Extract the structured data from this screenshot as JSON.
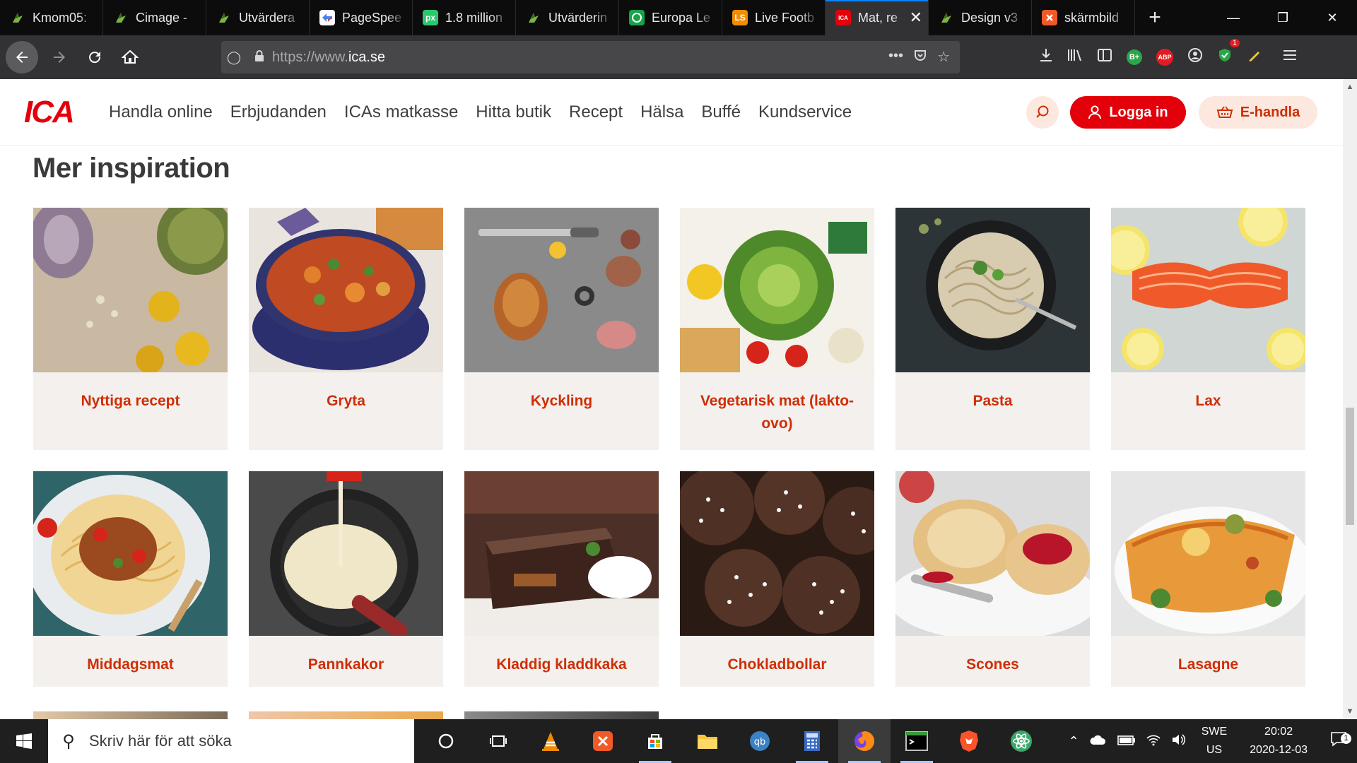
{
  "browser": {
    "tabs": [
      {
        "title": "Kmom05:",
        "icon": "web-icon",
        "color": "#3a5a1a"
      },
      {
        "title": "Cimage -",
        "icon": "web-icon",
        "color": "#3a5a1a"
      },
      {
        "title": "Utvärdera",
        "icon": "web-icon",
        "color": "#3a5a1a"
      },
      {
        "title": "PageSpee",
        "icon": "pagespeed-icon",
        "color": "#ffffff"
      },
      {
        "title": "1.8 million",
        "icon": "pixabay-icon",
        "color": "#2ec66d"
      },
      {
        "title": "Utvärderin",
        "icon": "web-icon",
        "color": "#3a5a1a"
      },
      {
        "title": "Europa Le",
        "icon": "europa-icon",
        "color": "#16a34a"
      },
      {
        "title": "Live Footb",
        "icon": "livescore-icon",
        "color": "#f28c00"
      },
      {
        "title": "Mat, re",
        "icon": "ica-icon",
        "color": "#e3000b",
        "active": true
      },
      {
        "title": "Design v3",
        "icon": "web-icon",
        "color": "#3a5a1a"
      },
      {
        "title": "skärmbild",
        "icon": "snip-icon",
        "color": "#f05a28"
      }
    ],
    "new_tab": "+",
    "url_proto": "https://www.",
    "url_domain": "ica.se",
    "url_dots": "•••",
    "abp_badge": "ABP",
    "b_badge": "B+",
    "update_count": "1"
  },
  "site": {
    "logo": "ICA",
    "nav": [
      "Handla online",
      "Erbjudanden",
      "ICAs matkasse",
      "Hitta butik",
      "Recept",
      "Hälsa",
      "Buffé",
      "Kundservice"
    ],
    "login": "Logga in",
    "ehandla": "E-handla",
    "section_title": "Mer inspiration",
    "cards": [
      {
        "label": "Nyttiga recept",
        "image": "vegetables-pumpkin"
      },
      {
        "label": "Gryta",
        "image": "stew-pot"
      },
      {
        "label": "Kyckling",
        "image": "roast-chicken"
      },
      {
        "label": "Vegetarisk mat (lakto-ovo)",
        "image": "cabbage-vegetables"
      },
      {
        "label": "Pasta",
        "image": "pasta-bowl"
      },
      {
        "label": "Lax",
        "image": "salmon-lemon"
      },
      {
        "label": "Middagsmat",
        "image": "spaghetti-bolognese"
      },
      {
        "label": "Pannkakor",
        "image": "pancake-batter-pan"
      },
      {
        "label": "Kladdig kladdkaka",
        "image": "chocolate-cake"
      },
      {
        "label": "Chokladbollar",
        "image": "chocolate-balls"
      },
      {
        "label": "Scones",
        "image": "scones-jam"
      },
      {
        "label": "Lasagne",
        "image": "lasagne"
      }
    ]
  },
  "taskbar": {
    "search_placeholder": "Skriv här för att söka",
    "lang_top": "SWE",
    "lang_bottom": "US",
    "time": "20:02",
    "date": "2020-12-03",
    "notifications": "1"
  }
}
